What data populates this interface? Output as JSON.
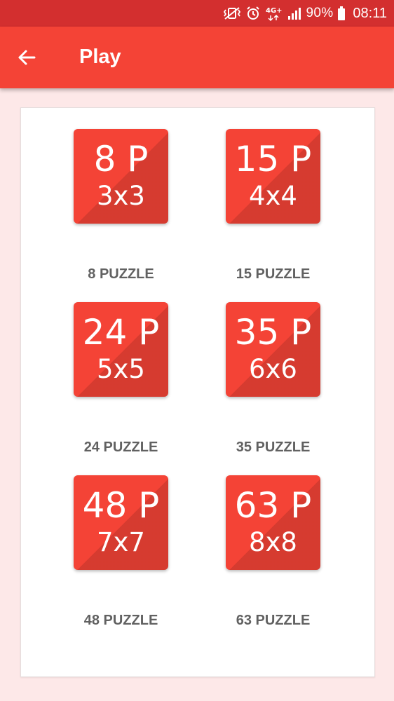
{
  "status_bar": {
    "battery": "90%",
    "time": "08:11",
    "network": "4G+",
    "icons": [
      "vibrate-icon",
      "alarm-icon",
      "signal-icon",
      "battery-icon"
    ]
  },
  "app_bar": {
    "title": "Play",
    "back_icon": "arrow-back-icon",
    "color": "#f44336"
  },
  "puzzles": [
    {
      "main": "8 P",
      "size": "3x3",
      "label": "8 PUZZLE"
    },
    {
      "main": "15 P",
      "size": "4x4",
      "label": "15 PUZZLE"
    },
    {
      "main": "24 P",
      "size": "5x5",
      "label": "24 PUZZLE"
    },
    {
      "main": "35 P",
      "size": "6x6",
      "label": "35 PUZZLE"
    },
    {
      "main": "48 P",
      "size": "7x7",
      "label": "48 PUZZLE"
    },
    {
      "main": "63 P",
      "size": "8x8",
      "label": "63 PUZZLE"
    }
  ]
}
